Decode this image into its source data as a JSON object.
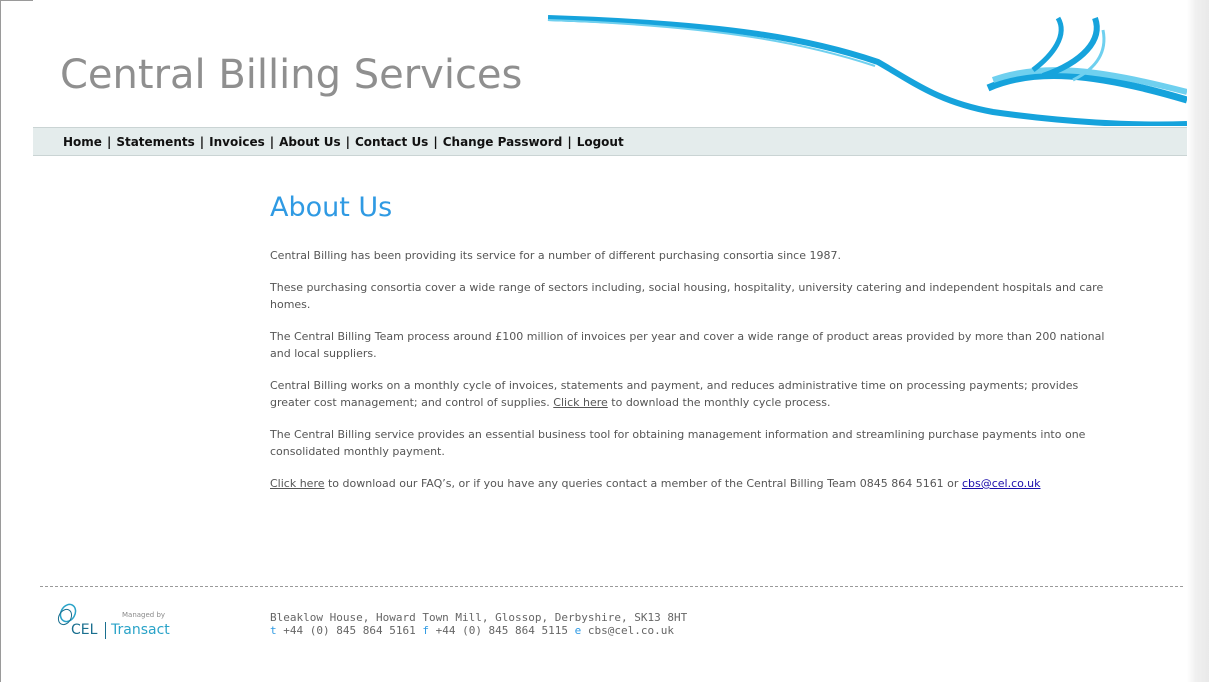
{
  "header": {
    "site_title": "Central Billing Services"
  },
  "nav": {
    "items": [
      {
        "label": "Home"
      },
      {
        "label": "Statements"
      },
      {
        "label": "Invoices"
      },
      {
        "label": "About Us"
      },
      {
        "label": "Contact Us"
      },
      {
        "label": "Change Password"
      },
      {
        "label": "Logout"
      }
    ],
    "separator": "|"
  },
  "main": {
    "heading": "About Us",
    "p1": "Central Billing has been providing its service for a number of different purchasing consortia since 1987.",
    "p2": "These purchasing consortia cover a wide range of sectors including, social housing, hospitality, university catering and independent hospitals and care homes.",
    "p3": "The Central Billing Team process around £100 million of invoices per year and cover a wide range of product areas provided by more than 200 national and local suppliers.",
    "p4_before": "Central Billing works on a monthly cycle of invoices, statements and payment, and reduces administrative time on processing payments; provides greater cost management; and control of supplies. ",
    "p4_link": "Click here",
    "p4_after": " to download the monthly cycle process.",
    "p5": "The Central Billing service provides an essential business tool for obtaining management information and streamlining purchase payments into one consolidated monthly payment.",
    "p6_link": "Click here",
    "p6_text": " to download our FAQ’s, or if you have any queries contact a member of the Central Billing Team 0845 864 5161 or ",
    "p6_email": "cbs@cel.co.uk"
  },
  "footer": {
    "managed_by": "Managed by",
    "logo_cel": "CEL",
    "logo_transact": "Transact",
    "address": "Bleaklow House, Howard Town Mill, Glossop, Derbyshire, SK13 8HT",
    "t_label": "t",
    "phone": "+44 (0) 845 864 5161",
    "f_label": "f",
    "fax": "+44 (0) 845 864 5115",
    "e_label": "e",
    "email": "cbs@cel.co.uk"
  },
  "colors": {
    "heading": "#2f9ae3",
    "nav_bg": "#e4ecec",
    "swoosh_light": "#6fd0ef",
    "swoosh_dark": "#16a3dc"
  }
}
